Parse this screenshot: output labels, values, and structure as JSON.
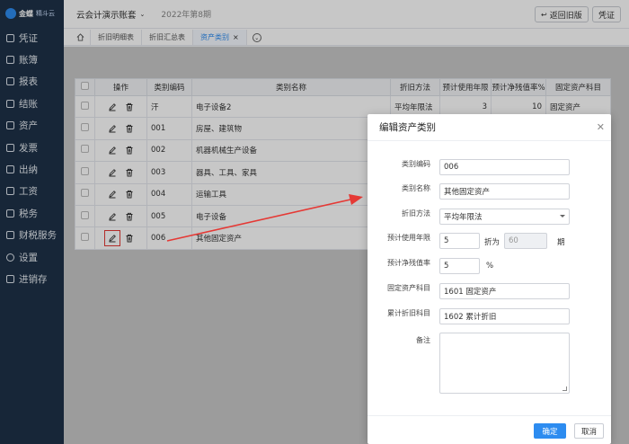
{
  "brand": {
    "name": "金蝶",
    "sub": "精斗云"
  },
  "sidebar": {
    "items": [
      {
        "label": "凭证",
        "icon": "voucher-icon"
      },
      {
        "label": "账簿",
        "icon": "ledger-icon"
      },
      {
        "label": "报表",
        "icon": "report-icon"
      },
      {
        "label": "结账",
        "icon": "close-accounts-icon"
      },
      {
        "label": "资产",
        "icon": "assets-icon"
      },
      {
        "label": "发票",
        "icon": "invoice-icon"
      },
      {
        "label": "出纳",
        "icon": "cashier-icon"
      },
      {
        "label": "工资",
        "icon": "salary-icon"
      },
      {
        "label": "税务",
        "icon": "tax-icon"
      },
      {
        "label": "财税服务",
        "icon": "tax-service-icon"
      },
      {
        "label": "设置",
        "icon": "settings-icon"
      },
      {
        "label": "进销存",
        "icon": "inventory-icon"
      }
    ]
  },
  "header": {
    "account_name": "云会计演示账套",
    "period": "2022年第8期",
    "back_button": "返回旧版",
    "voucher_button": "凭证"
  },
  "tabs": [
    {
      "label": "折旧明细表"
    },
    {
      "label": "折旧汇总表"
    },
    {
      "label": "资产类别",
      "active": true
    }
  ],
  "table": {
    "headers": [
      "操作",
      "类别编码",
      "类别名称",
      "折旧方法",
      "预计使用年限",
      "预计净残值率%",
      "固定资产科目"
    ],
    "rows": [
      {
        "code": "汗",
        "name": "电子设备2",
        "method": "平均年限法",
        "years": "3",
        "rate": "10",
        "account": "固定资产"
      },
      {
        "code": "001",
        "name": "房屋、建筑物",
        "method": "",
        "years": "",
        "rate": "",
        "account": ""
      },
      {
        "code": "002",
        "name": "机器机械生产设备",
        "method": "",
        "years": "",
        "rate": "",
        "account": ""
      },
      {
        "code": "003",
        "name": "器具、工具、家具",
        "method": "",
        "years": "",
        "rate": "",
        "account": ""
      },
      {
        "code": "004",
        "name": "运输工具",
        "method": "",
        "years": "",
        "rate": "",
        "account": ""
      },
      {
        "code": "005",
        "name": "电子设备",
        "method": "",
        "years": "",
        "rate": "",
        "account": ""
      },
      {
        "code": "006",
        "name": "其他固定资产",
        "method": "",
        "years": "",
        "rate": "",
        "account": ""
      }
    ]
  },
  "dialog": {
    "title": "编辑资产类别",
    "fields": {
      "code_label": "类别编码",
      "code_value": "006",
      "name_label": "类别名称",
      "name_value": "其他固定资产",
      "method_label": "折旧方法",
      "method_value": "平均年限法",
      "years_label": "预计使用年限",
      "years_value": "5",
      "months_prefix": "折为",
      "months_value": "60",
      "months_suffix": "期",
      "rate_label": "预计净残值率",
      "rate_value": "5",
      "rate_suffix": "%",
      "asset_account_label": "固定资产科目",
      "asset_account_value": "1601 固定资产",
      "dep_account_label": "累计折旧科目",
      "dep_account_value": "1602 累计折旧",
      "note_label": "备注"
    },
    "ok_button": "确定",
    "cancel_button": "取消"
  },
  "colors": {
    "sidebar": "#1e3148",
    "accent": "#2d8cf0",
    "highlight": "#e53935"
  }
}
